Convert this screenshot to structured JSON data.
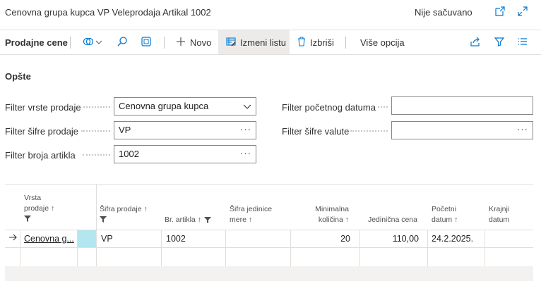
{
  "window": {
    "title": "Cenovna grupa kupca VP Veleprodaja Artikal 1002",
    "save_status": "Nije sačuvano",
    "icons": [
      "open-new-window-icon",
      "expand-icon"
    ]
  },
  "actionbar": {
    "page_name": "Prodajne cene",
    "new_label": "Novo",
    "edit_list_label": "Izmeni listu",
    "delete_label": "Izbriši",
    "more_label": "Više opcija"
  },
  "section": {
    "title": "Opšte"
  },
  "filters": {
    "sales_type_label": "Filter vrste prodaje",
    "sales_type_value": "Cenovna grupa kupca",
    "sales_code_label": "Filter šifre prodaje",
    "sales_code_value": "VP",
    "item_no_label": "Filter broja artikla",
    "item_no_value": "1002",
    "start_date_label": "Filter početnog datuma",
    "start_date_value": "",
    "currency_label": "Filter šifre valute",
    "currency_value": ""
  },
  "grid": {
    "headers": {
      "sales_type": [
        "Vrsta",
        "prodaje ↑"
      ],
      "sales_code": [
        "Šifra prodaje ↑"
      ],
      "item_no": [
        "Br. artikla ↑"
      ],
      "uom": [
        "Šifra jedinice",
        "mere ↑"
      ],
      "min_qty": [
        "Minimalna",
        "količina ↑"
      ],
      "unit_price": [
        "Jedinična cena"
      ],
      "start_date": [
        "Početni",
        "datum ↑"
      ],
      "end_date": [
        "Krajnji",
        "datum"
      ]
    },
    "rows": [
      {
        "sales_type": "Cenovna g...",
        "sales_code": "VP",
        "item_no": "1002",
        "uom": "",
        "min_qty": "20",
        "unit_price": "110,00",
        "start_date": "24.2.2025.",
        "end_date": ""
      }
    ],
    "colors": {
      "accent_cell": "#b3e6ee",
      "footer": "#f3f2f1"
    }
  }
}
